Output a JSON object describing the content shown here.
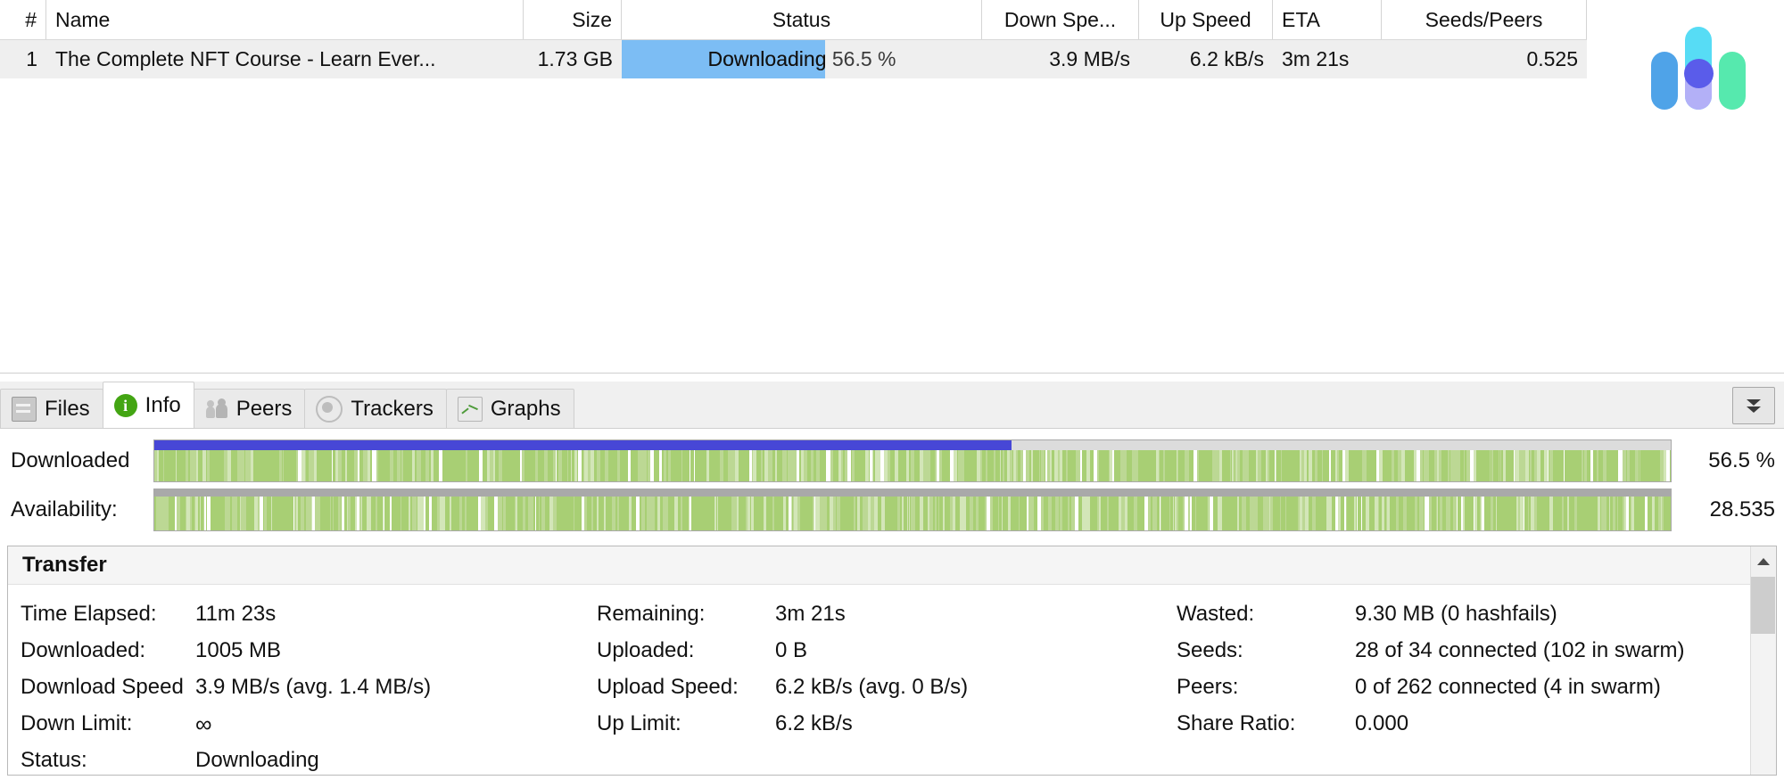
{
  "torrent_list": {
    "columns": [
      {
        "key": "num",
        "label": "#"
      },
      {
        "key": "name",
        "label": "Name"
      },
      {
        "key": "size",
        "label": "Size"
      },
      {
        "key": "status",
        "label": "Status"
      },
      {
        "key": "down_speed",
        "label": "Down Spe..."
      },
      {
        "key": "up_speed",
        "label": "Up Speed"
      },
      {
        "key": "eta",
        "label": "ETA"
      },
      {
        "key": "seeds_peers",
        "label": "Seeds/Peers"
      }
    ],
    "rows": [
      {
        "num": "1",
        "name": "The Complete NFT Course - Learn Ever...",
        "size": "1.73 GB",
        "status_text": "Downloading 56.5 %",
        "status_percent": 56.5,
        "down_speed": "3.9 MB/s",
        "up_speed": "6.2 kB/s",
        "eta": "3m 21s",
        "seeds_peers": "0.525"
      }
    ]
  },
  "logo": {
    "name": "app-logo",
    "colors": {
      "left_bar": "#4fa3e8",
      "mid_top": "#57dcf5",
      "mid_bottom": "#b3b0f7",
      "right_bar": "#56e9ae",
      "dot": "#5a5cea"
    }
  },
  "detail_tabs": {
    "items": [
      {
        "label": "Files",
        "icon": "folder-icon",
        "active": false
      },
      {
        "label": "Info",
        "icon": "info-icon",
        "active": true
      },
      {
        "label": "Peers",
        "icon": "peers-icon",
        "active": false
      },
      {
        "label": "Trackers",
        "icon": "trackers-icon",
        "active": false
      },
      {
        "label": "Graphs",
        "icon": "graphs-icon",
        "active": false
      }
    ],
    "collapse_button": "collapse-panel-icon"
  },
  "bitfields": [
    {
      "label": "Downloaded",
      "value": "56.5 %",
      "percent": 56.5,
      "has_top_progress": true,
      "top_fill_color": "#4747d6"
    },
    {
      "label": "Availability:",
      "value": "28.535",
      "percent": 100,
      "has_top_progress": false,
      "top_fill_color": "#a9a9a9"
    }
  ],
  "transfer": {
    "title": "Transfer",
    "col1": [
      {
        "label": "Time Elapsed:",
        "value": "11m 23s"
      },
      {
        "label": "Downloaded:",
        "value": "1005 MB"
      },
      {
        "label": "Download Speed",
        "value": "3.9 MB/s (avg. 1.4 MB/s)"
      },
      {
        "label": "Down Limit:",
        "value": "∞"
      },
      {
        "label": "Status:",
        "value": "Downloading"
      }
    ],
    "col2": [
      {
        "label": "Remaining:",
        "value": "3m 21s"
      },
      {
        "label": "Uploaded:",
        "value": "0 B"
      },
      {
        "label": "Upload Speed:",
        "value": "6.2 kB/s (avg. 0 B/s)"
      },
      {
        "label": "Up Limit:",
        "value": "6.2 kB/s"
      }
    ],
    "col3": [
      {
        "label": "Wasted:",
        "value": "9.30 MB (0 hashfails)"
      },
      {
        "label": "Seeds:",
        "value": "28 of 34 connected (102 in swarm)"
      },
      {
        "label": "Peers:",
        "value": "0 of 262 connected (4 in swarm)"
      },
      {
        "label": "Share Ratio:",
        "value": "0.000"
      }
    ]
  }
}
